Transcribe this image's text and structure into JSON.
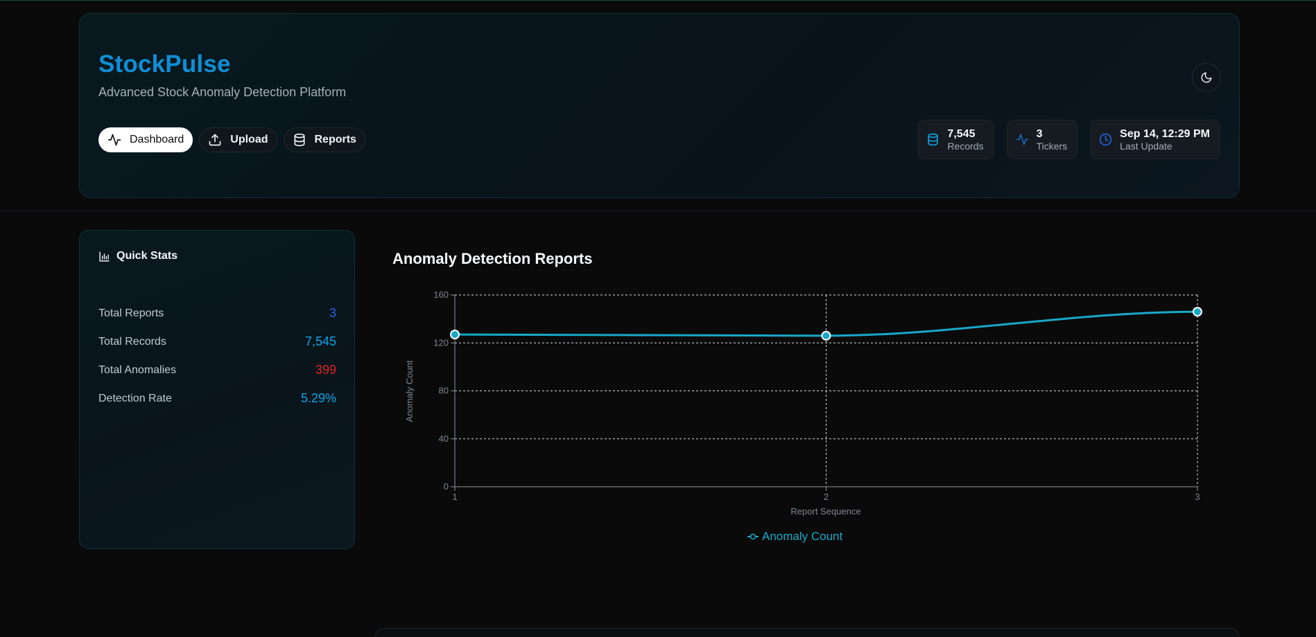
{
  "header": {
    "brand": "StockPulse",
    "tagline": "Advanced Stock Anomaly Detection Platform",
    "theme_icon": "moon-icon",
    "nav": [
      {
        "label": "Dashboard",
        "icon": "activity-icon",
        "active": true
      },
      {
        "label": "Upload",
        "icon": "upload-icon",
        "active": false
      },
      {
        "label": "Reports",
        "icon": "database-icon",
        "active": false
      }
    ],
    "stats": [
      {
        "value": "7,545",
        "label": "Records",
        "icon": "database-icon",
        "color": "#0ea5e9"
      },
      {
        "value": "3",
        "label": "Tickers",
        "icon": "activity-icon",
        "color": "#1d6bd4"
      },
      {
        "value": "Sep 14, 12:29 PM",
        "label": "Last Update",
        "icon": "clock-icon",
        "color": "#2563eb"
      }
    ]
  },
  "quick_stats": {
    "title": "Quick Stats",
    "icon": "bar-chart-icon",
    "rows": [
      {
        "label": "Total Reports",
        "value": "3",
        "color": "#2563eb"
      },
      {
        "label": "Total Records",
        "value": "7,545",
        "color": "#0ea5e9"
      },
      {
        "label": "Total Anomalies",
        "value": "399",
        "color": "#dc2626"
      },
      {
        "label": "Detection Rate",
        "value": "5.29%",
        "color": "#0ea5e9"
      }
    ]
  },
  "chart": {
    "title": "Anomaly Detection Reports"
  },
  "chart_data": {
    "type": "line",
    "x": [
      1,
      2,
      3
    ],
    "xticks": [
      "1",
      "2",
      "3"
    ],
    "yticks": [
      "0",
      "40",
      "80",
      "120",
      "160"
    ],
    "series": [
      {
        "name": "Anomaly Count",
        "values": [
          127,
          126,
          146
        ],
        "color": "#17a9c9"
      }
    ],
    "xlabel": "Report Sequence",
    "ylabel": "Anomaly Count",
    "ylim": [
      0,
      160
    ],
    "grid": true,
    "legend": "bottom-center"
  }
}
